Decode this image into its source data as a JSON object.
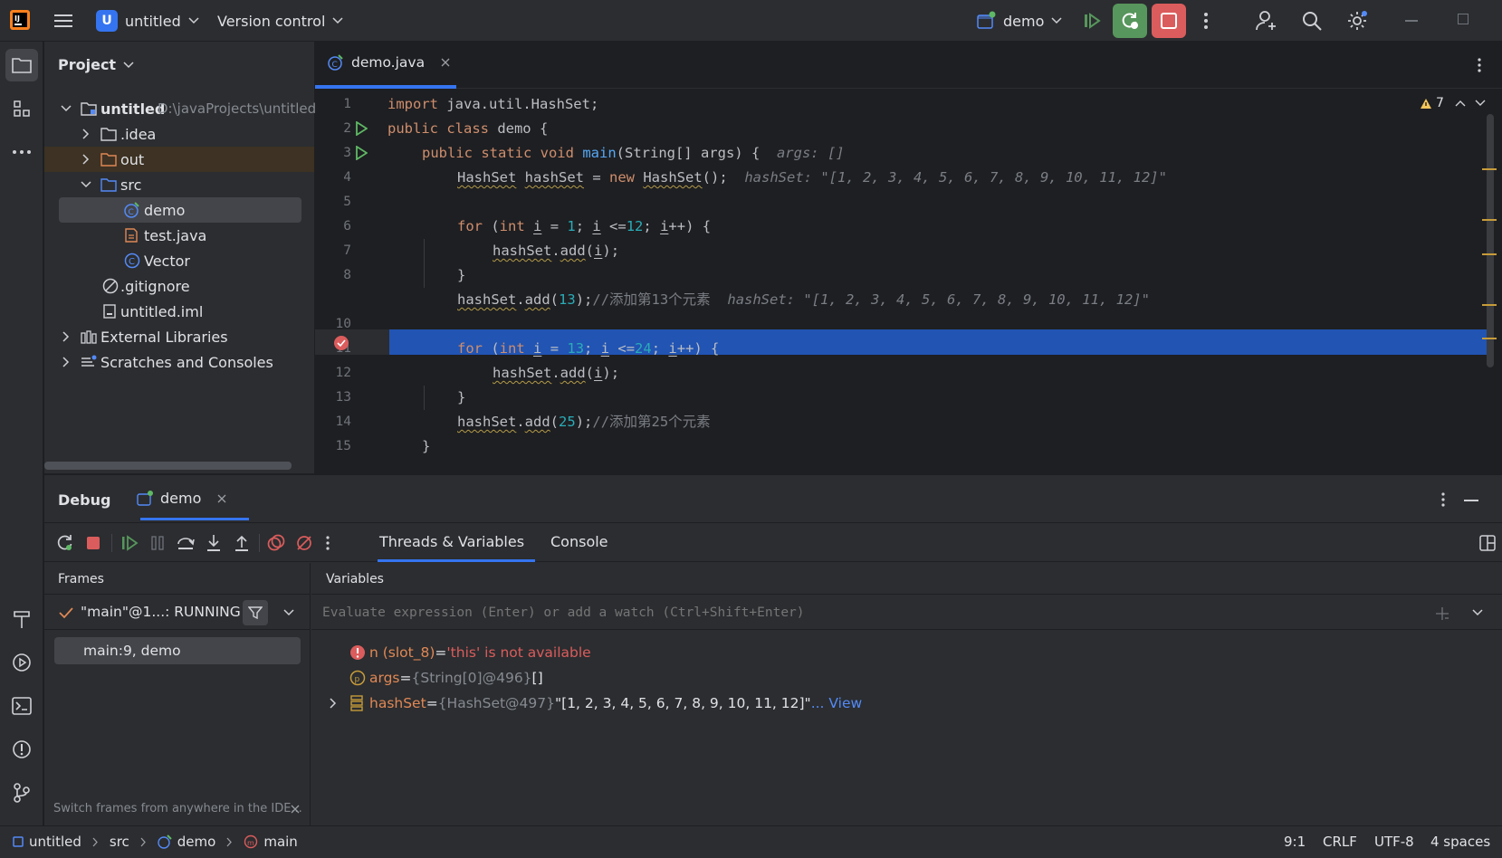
{
  "titlebar": {
    "project_letter": "U",
    "project_name": "untitled",
    "vcs": "Version control",
    "run_config": "demo"
  },
  "project_panel": {
    "title": "Project",
    "tree": [
      {
        "label": "untitled",
        "path": "D:\\javaProjects\\untitled"
      },
      {
        "label": ".idea"
      },
      {
        "label": "out"
      },
      {
        "label": "src"
      },
      {
        "label": "demo"
      },
      {
        "label": "test.java"
      },
      {
        "label": "Vector"
      },
      {
        "label": ".gitignore"
      },
      {
        "label": "untitled.iml"
      },
      {
        "label": "External Libraries"
      },
      {
        "label": "Scratches and Consoles"
      }
    ]
  },
  "editor": {
    "tab": "demo.java",
    "warnings": "7",
    "line_numbers": [
      "1",
      "2",
      "3",
      "4",
      "5",
      "6",
      "7",
      "8",
      "",
      "10",
      "11",
      "12",
      "13",
      "14",
      "15"
    ],
    "lines": {
      "l1a": "import",
      "l1b": " java.util.HashSet;",
      "l2a": "public class",
      "l2b": " demo {",
      "l3a": "public static void",
      "l3b": "main",
      "l3c": "(String[] args) {",
      "l3h": "args: []",
      "l4a": "HashSet",
      "l4b": "hashSet",
      "l4c": " = ",
      "l4d": "new",
      "l4e": "HashSet",
      "l4f": "();",
      "l4h": "hashSet: \"[1, 2, 3, 4, 5, 6, 7, 8, 9, 10, 11, 12]\"",
      "l6a": "for",
      "l6b": " (",
      "l6c": "int",
      "l6d": "i",
      "l6e": " = ",
      "l6f": "1",
      "l6g": "; ",
      "l6h": "i",
      "l6i": " <=",
      "l6j": "12",
      "l6k": "; ",
      "l6l": "i",
      "l6m": "++) {",
      "l7a": "hashSet",
      "l7b": ".",
      "l7c": "add",
      "l7d": "(",
      "l7e": "i",
      "l7f": ");",
      "l8": "}",
      "l9a": "hashSet",
      "l9b": ".",
      "l9c": "add",
      "l9d": "(",
      "l9e": "13",
      "l9f": ");",
      "l9g": "//添加第13个元素",
      "l9h": "hashSet: \"[1, 2, 3, 4, 5, 6, 7, 8, 9, 10, 11, 12]\"",
      "l11a": "for",
      "l11b": " (",
      "l11c": "int",
      "l11d": "i",
      "l11e": " = ",
      "l11f": "13",
      "l11g": "; ",
      "l11h": "i",
      "l11i": " <=",
      "l11j": "24",
      "l11k": "; ",
      "l11l": "i",
      "l11m": "++) {",
      "l12a": "hashSet",
      "l12b": ".",
      "l12c": "add",
      "l12d": "(",
      "l12e": "i",
      "l12f": ");",
      "l13": "}",
      "l14a": "hashSet",
      "l14b": ".",
      "l14c": "add",
      "l14d": "(",
      "l14e": "25",
      "l14f": ");",
      "l14g": "//添加第25个元素",
      "l15": "}"
    }
  },
  "debug": {
    "title": "Debug",
    "session_tab": "demo",
    "tabs": [
      "Threads & Variables",
      "Console"
    ],
    "frames_header": "Frames",
    "variables_header": "Variables",
    "thread": "\"main\"@1...: RUNNING",
    "frame": "main:9, demo",
    "eval_placeholder": "Evaluate expression (Enter) or add a watch (Ctrl+Shift+Enter)",
    "hint": "Switch frames from anywhere in the IDE...",
    "variables": [
      {
        "name": "n (slot_8)",
        "eq": " = ",
        "value": "'this' is not available"
      },
      {
        "name": "args",
        "eq": " = ",
        "ref": "{String[0]@496}",
        "value": " []"
      },
      {
        "name": "hashSet",
        "eq": " = ",
        "ref": "{HashSet@497}",
        "value": " \"[1, 2, 3, 4, 5, 6, 7, 8, 9, 10, 11, 12]\"",
        "link": "... View"
      }
    ]
  },
  "statusbar": {
    "breadcrumbs": [
      "untitled",
      "src",
      "demo",
      "main"
    ],
    "position": "9:1",
    "line_sep": "CRLF",
    "encoding": "UTF-8",
    "indent": "4 spaces"
  },
  "colors": {
    "accent": "#3574f0",
    "execution_line": "#2154b3",
    "run_green": "#57965c",
    "stop_red": "#db5c5c",
    "selection": "#43454a"
  }
}
